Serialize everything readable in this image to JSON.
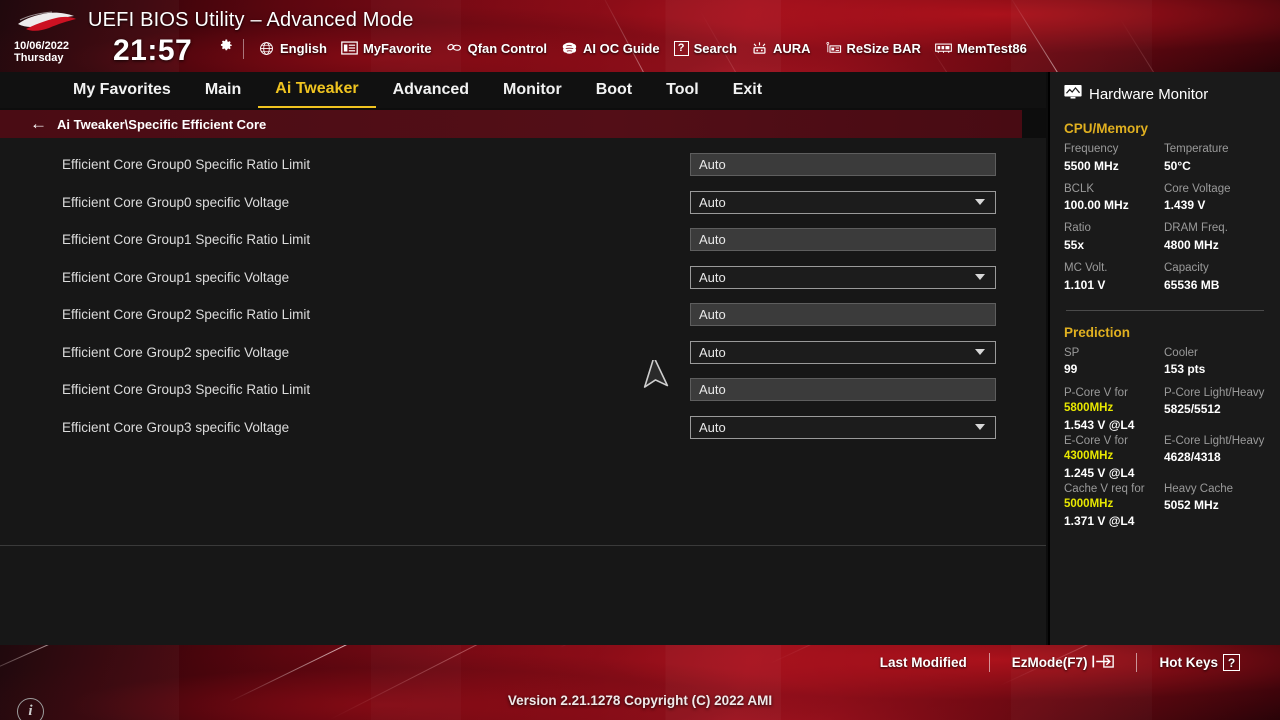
{
  "header": {
    "title": "UEFI BIOS Utility – Advanced Mode",
    "date": "10/06/2022",
    "weekday": "Thursday",
    "time": "21:57",
    "gear_icon": "gear-icon",
    "toolbar": [
      {
        "label": "English",
        "icon": "globe-icon"
      },
      {
        "label": "MyFavorite",
        "icon": "star-list-icon"
      },
      {
        "label": "Qfan Control",
        "icon": "fan-icon"
      },
      {
        "label": "AI OC Guide",
        "icon": "brain-icon"
      },
      {
        "label": "Search",
        "icon": "question-box-icon"
      },
      {
        "label": "AURA",
        "icon": "aura-light-icon"
      },
      {
        "label": "ReSize BAR",
        "icon": "resize-bar-icon"
      },
      {
        "label": "MemTest86",
        "icon": "memory-icon"
      }
    ]
  },
  "menu": {
    "tabs": [
      {
        "label": "My Favorites",
        "active": false
      },
      {
        "label": "Main",
        "active": false
      },
      {
        "label": "Ai Tweaker",
        "active": true
      },
      {
        "label": "Advanced",
        "active": false
      },
      {
        "label": "Monitor",
        "active": false
      },
      {
        "label": "Boot",
        "active": false
      },
      {
        "label": "Tool",
        "active": false
      },
      {
        "label": "Exit",
        "active": false
      }
    ]
  },
  "breadcrumb": {
    "back_arrow": "←",
    "path": "Ai Tweaker\\Specific Efficient Core"
  },
  "settings": [
    {
      "label": "Efficient Core Group0 Specific Ratio Limit",
      "value": "Auto",
      "type": "text"
    },
    {
      "label": "Efficient Core Group0 specific Voltage",
      "value": "Auto",
      "type": "dropdown"
    },
    {
      "label": "Efficient Core Group1 Specific Ratio Limit",
      "value": "Auto",
      "type": "text"
    },
    {
      "label": "Efficient Core Group1 specific Voltage",
      "value": "Auto",
      "type": "dropdown"
    },
    {
      "label": "Efficient Core Group2 Specific Ratio Limit",
      "value": "Auto",
      "type": "text"
    },
    {
      "label": "Efficient Core Group2 specific Voltage",
      "value": "Auto",
      "type": "dropdown"
    },
    {
      "label": "Efficient Core Group3 Specific Ratio Limit",
      "value": "Auto",
      "type": "text"
    },
    {
      "label": "Efficient Core Group3 specific Voltage",
      "value": "Auto",
      "type": "dropdown"
    }
  ],
  "info_icon": "i",
  "sidebar": {
    "title": "Hardware Monitor",
    "title_icon": "monitor-icon",
    "sections": [
      {
        "name": "CPU/Memory",
        "pairs": [
          {
            "key": "Frequency",
            "value": "5500 MHz"
          },
          {
            "key": "Temperature",
            "value": "50°C"
          },
          {
            "key": "BCLK",
            "value": "100.00 MHz"
          },
          {
            "key": "Core Voltage",
            "value": "1.439 V"
          },
          {
            "key": "Ratio",
            "value": "55x"
          },
          {
            "key": "DRAM Freq.",
            "value": "4800 MHz"
          },
          {
            "key": "MC Volt.",
            "value": "1.101 V"
          },
          {
            "key": "Capacity",
            "value": "65536 MB"
          }
        ]
      },
      {
        "name": "Prediction",
        "pairs": [
          {
            "key": "SP",
            "value": "99"
          },
          {
            "key": "Cooler",
            "value": "153 pts"
          }
        ],
        "predictions": [
          {
            "left_key_pre": "P-Core V for",
            "left_key_hl": "5800MHz",
            "left_value": "1.543 V @L4",
            "right_key": "P-Core Light/Heavy",
            "right_value": "5825/5512"
          },
          {
            "left_key_pre": "E-Core V for",
            "left_key_hl": "4300MHz",
            "left_value": "1.245 V @L4",
            "right_key": "E-Core Light/Heavy",
            "right_value": "4628/4318"
          },
          {
            "left_key_pre": "Cache V req for",
            "left_key_hl": "5000MHz",
            "left_value": "1.371 V @L4",
            "right_key": "Heavy Cache",
            "right_value": "5052 MHz"
          }
        ]
      }
    ]
  },
  "footer": {
    "last_modified": "Last Modified",
    "ezmode": "EzMode(F7)",
    "ezmode_icon": "exit-arrow-icon",
    "hotkeys": "Hot Keys",
    "hotkeys_icon": "question-box-icon",
    "version": "Version 2.21.1278 Copyright (C) 2022 AMI"
  },
  "cursor": {
    "name": "mouse-pointer"
  }
}
